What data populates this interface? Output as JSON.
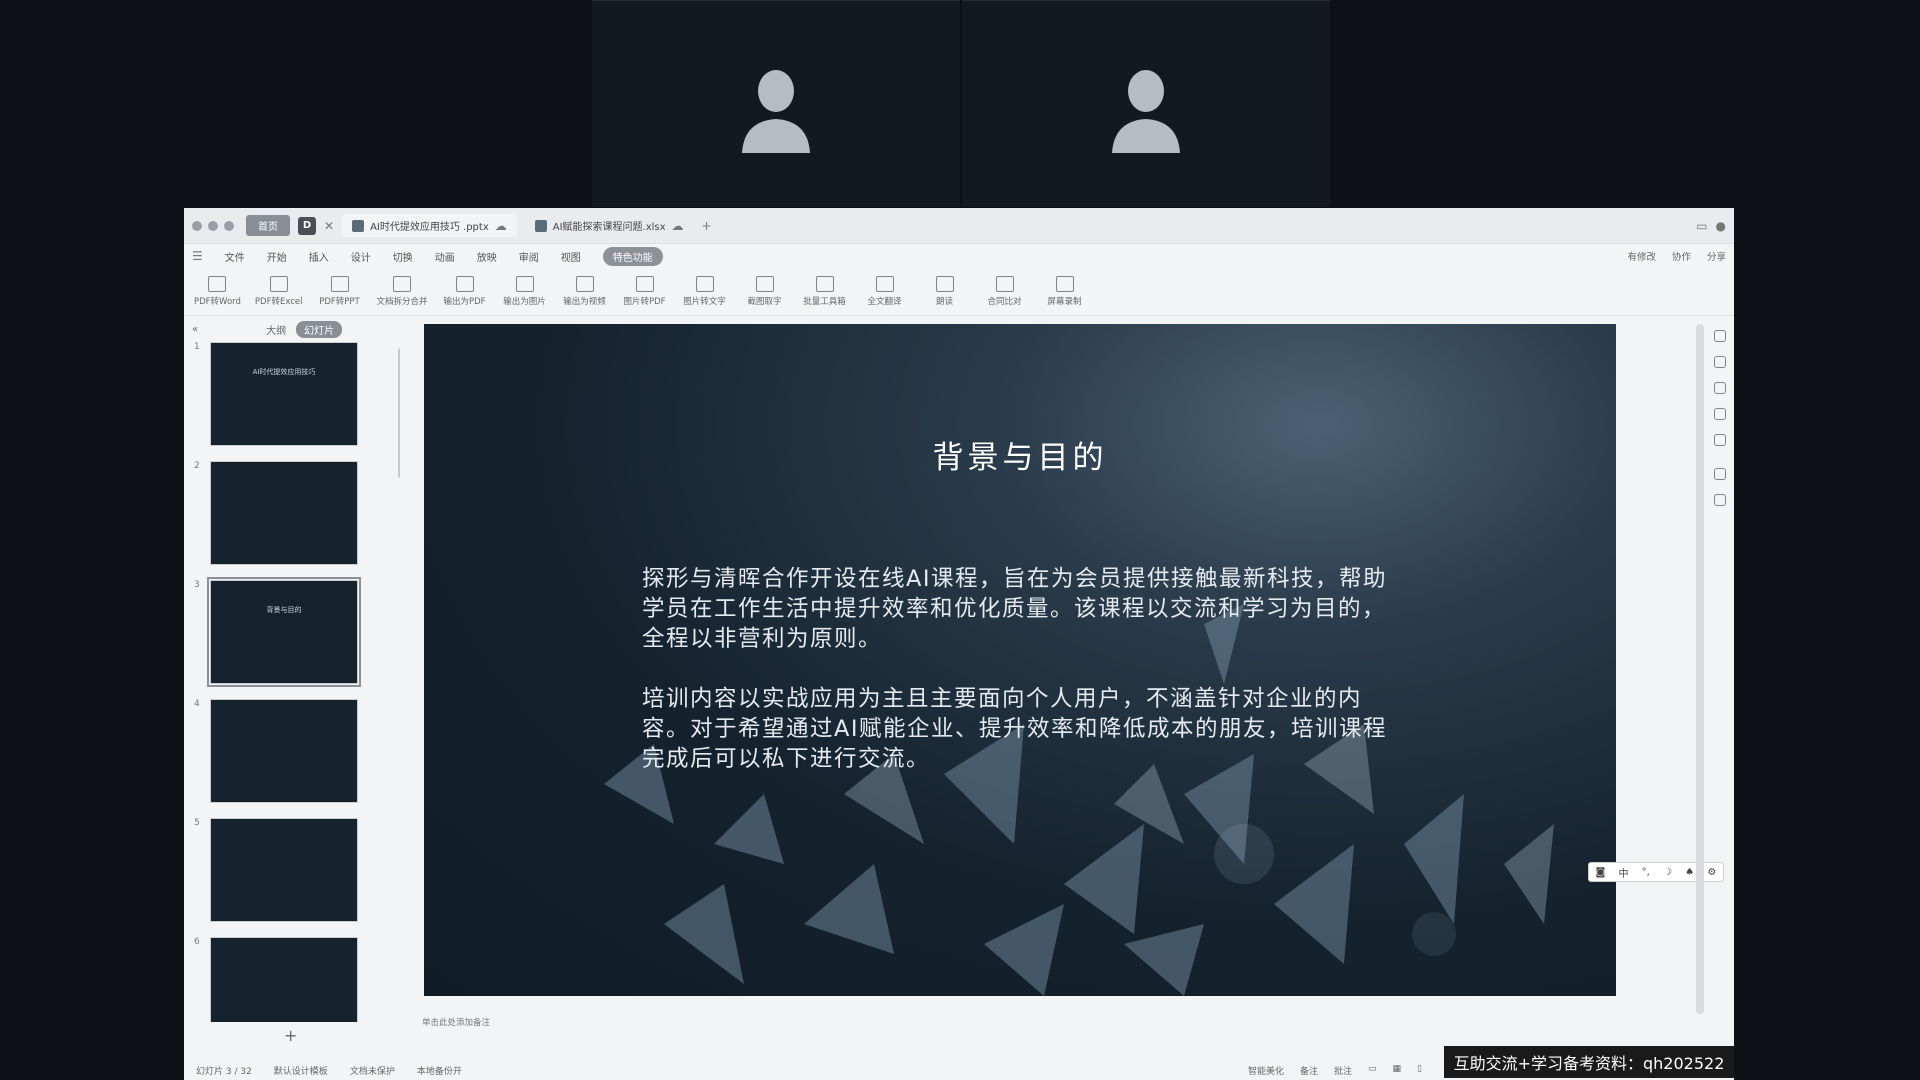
{
  "meeting": {
    "participants": [
      {
        "icon": "person-silhouette-icon"
      },
      {
        "icon": "person-silhouette-icon"
      }
    ]
  },
  "titlebar": {
    "home_label": "首页",
    "app_letter": "D",
    "tabs": [
      {
        "label": "AI时代提效应用技巧 .pptx",
        "active": true
      },
      {
        "label": "AI赋能探索课程问题.xlsx",
        "active": false
      }
    ],
    "new_tab": "+"
  },
  "menubar": {
    "items": [
      "文件",
      "开始",
      "插入",
      "设计",
      "切换",
      "动画",
      "放映",
      "审阅",
      "视图",
      "特色功能"
    ],
    "highlight_index": 9,
    "right_items": [
      "有修改",
      "协作",
      "分享"
    ]
  },
  "toolbar": {
    "tools": [
      "PDF转Word",
      "PDF转Excel",
      "PDF转PPT",
      "文档拆分合并",
      "输出为PDF",
      "输出为图片",
      "输出为视频",
      "图片转PDF",
      "图片转文字",
      "截图取字",
      "批量工具箱",
      "全文翻译",
      "朗读",
      "合同比对",
      "屏幕录制"
    ]
  },
  "left_panel": {
    "tab_outline": "大纲",
    "tab_slides": "幻灯片",
    "thumbnails": [
      {
        "num": "1",
        "caption": "AI时代提效应用技巧"
      },
      {
        "num": "2",
        "caption": ""
      },
      {
        "num": "3",
        "caption": "背景与目的"
      },
      {
        "num": "4",
        "caption": ""
      },
      {
        "num": "5",
        "caption": ""
      },
      {
        "num": "6",
        "caption": ""
      }
    ],
    "selected_index": 2,
    "add_label": "+"
  },
  "slide": {
    "title": "背景与目的",
    "paragraphs": [
      "探形与清晖合作开设在线AI课程，旨在为会员提供接触最新科技，帮助学员在工作生活中提升效率和优化质量。该课程以交流和学习为目的，全程以非营利为原则。",
      "培训内容以实战应用为主且主要面向个人用户，不涵盖针对企业的内容。对于希望通过AI赋能企业、提升效率和降低成本的朋友，培训课程完成后可以私下进行交流。"
    ],
    "notes_placeholder": "单击此处添加备注"
  },
  "ime": {
    "mode": "中"
  },
  "statusbar": {
    "slide_counter": "幻灯片 3 / 32",
    "template": "默认设计模板",
    "doc_status": "文档未保护",
    "backup": "本地备份开",
    "right_items": [
      "智能美化",
      "备注",
      "批注"
    ]
  },
  "overlay": {
    "promo_text": "互助交流+学习备考资料：qh202522"
  }
}
